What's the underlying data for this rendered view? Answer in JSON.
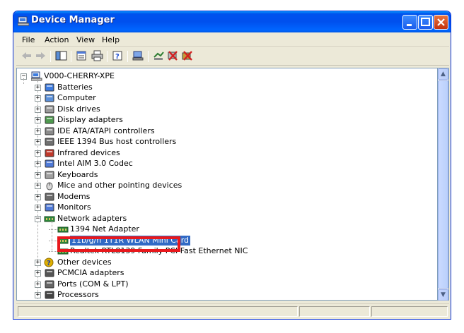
{
  "window": {
    "title": "Device Manager"
  },
  "menu": [
    "File",
    "Action",
    "View",
    "Help"
  ],
  "toolbar": {
    "icons": [
      "back-arrow-icon",
      "forward-arrow-icon",
      "console-tree-icon",
      "properties-icon",
      "print-icon",
      "help-icon",
      "scan-hardware-icon",
      "update-driver-icon",
      "disable-device-icon",
      "uninstall-device-icon"
    ]
  },
  "tree": {
    "root": "V000-CHERRY-XPE",
    "categories": [
      {
        "label": "Batteries",
        "icon": "battery-icon"
      },
      {
        "label": "Computer",
        "icon": "computer-icon"
      },
      {
        "label": "Disk drives",
        "icon": "disk-drive-icon"
      },
      {
        "label": "Display adapters",
        "icon": "display-adapter-icon"
      },
      {
        "label": "IDE ATA/ATAPI controllers",
        "icon": "ide-controller-icon"
      },
      {
        "label": "IEEE 1394 Bus host controllers",
        "icon": "ieee1394-icon"
      },
      {
        "label": "Infrared devices",
        "icon": "infrared-icon"
      },
      {
        "label": "Intel AIM 3.0 Codec",
        "icon": "codec-icon"
      },
      {
        "label": "Keyboards",
        "icon": "keyboard-icon"
      },
      {
        "label": "Mice and other pointing devices",
        "icon": "mouse-icon"
      },
      {
        "label": "Modems",
        "icon": "modem-icon"
      },
      {
        "label": "Monitors",
        "icon": "monitor-icon"
      },
      {
        "label": "Network adapters",
        "icon": "network-adapter-icon"
      }
    ],
    "network_children": [
      {
        "label": "1394 Net Adapter"
      },
      {
        "label": "11b/g/n 1T1R WLAN Mini Card"
      },
      {
        "label": "Realtek RTL8139 Family PCI Fast Ethernet NIC"
      }
    ],
    "more_categories": [
      {
        "label": "Other devices",
        "icon": "unknown-device-icon"
      },
      {
        "label": "PCMCIA adapters",
        "icon": "pcmcia-icon"
      },
      {
        "label": "Ports (COM & LPT)",
        "icon": "port-icon"
      },
      {
        "label": "Processors",
        "icon": "processor-icon"
      }
    ]
  },
  "colors": {
    "selection": "#316ac5",
    "highlight_box": "#e8181c",
    "titlebar": "#0053ee"
  }
}
